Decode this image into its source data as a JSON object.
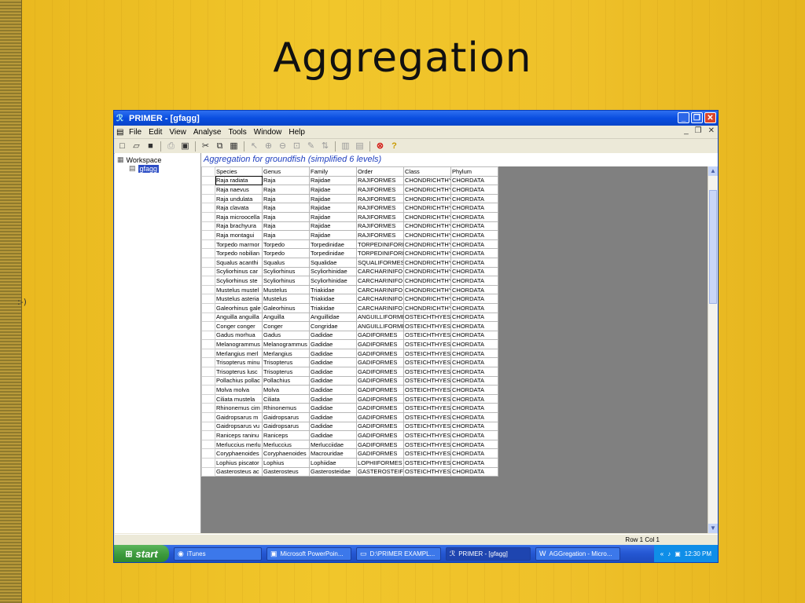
{
  "slide": {
    "title": "Aggregation",
    "side_note": ":-)"
  },
  "window": {
    "title": "PRIMER - [gfagg]"
  },
  "menu": [
    "File",
    "Edit",
    "View",
    "Analyse",
    "Tools",
    "Window",
    "Help"
  ],
  "toolbar_icons": [
    "new-icon",
    "open-icon",
    "save-icon",
    "print-icon",
    "print-preview-icon",
    "cut-icon",
    "copy-icon",
    "paste-icon",
    "pointer-icon",
    "zoom-in-icon",
    "zoom-out-icon",
    "select-icon",
    "edit-icon",
    "sort-icon",
    "chart-icon",
    "chart2-icon",
    "stop-icon",
    "help-icon"
  ],
  "tree": {
    "root": "Workspace",
    "child": "gfagg"
  },
  "sheet": {
    "title": "Aggregation for groundfish (simplified 6 levels)",
    "columns": [
      "Species",
      "Genus",
      "Family",
      "Order",
      "Class",
      "Phylum"
    ],
    "rows": [
      [
        "Raja radiata",
        "Raja",
        "Rajidae",
        "RAJIFORMES",
        "CHONDRICHTHY",
        "CHORDATA"
      ],
      [
        "Raja naevus",
        "Raja",
        "Rajidae",
        "RAJIFORMES",
        "CHONDRICHTHY",
        "CHORDATA"
      ],
      [
        "Raja undulata",
        "Raja",
        "Rajidae",
        "RAJIFORMES",
        "CHONDRICHTHY",
        "CHORDATA"
      ],
      [
        "Raja clavata",
        "Raja",
        "Rajidae",
        "RAJIFORMES",
        "CHONDRICHTHY",
        "CHORDATA"
      ],
      [
        "Raja microocella",
        "Raja",
        "Rajidae",
        "RAJIFORMES",
        "CHONDRICHTHY",
        "CHORDATA"
      ],
      [
        "Raja brachyura",
        "Raja",
        "Rajidae",
        "RAJIFORMES",
        "CHONDRICHTHY",
        "CHORDATA"
      ],
      [
        "Raja montagui",
        "Raja",
        "Rajidae",
        "RAJIFORMES",
        "CHONDRICHTHY",
        "CHORDATA"
      ],
      [
        "Torpedo marmor",
        "Torpedo",
        "Torpedinidae",
        "TORPEDINIFORI",
        "CHONDRICHTHY",
        "CHORDATA"
      ],
      [
        "Torpedo nobilian",
        "Torpedo",
        "Torpedinidae",
        "TORPEDINIFORI",
        "CHONDRICHTHY",
        "CHORDATA"
      ],
      [
        "Squalus acanthi",
        "Squalus",
        "Squalidae",
        "SQUALIFORMES",
        "CHONDRICHTHY",
        "CHORDATA"
      ],
      [
        "Scyliorhinus car",
        "Scyliorhinus",
        "Scyliorhinidae",
        "CARCHARINIFO",
        "CHONDRICHTHY",
        "CHORDATA"
      ],
      [
        "Scyliorhinus ste",
        "Scyliorhinus",
        "Scyliorhinidae",
        "CARCHARINIFO",
        "CHONDRICHTHY",
        "CHORDATA"
      ],
      [
        "Mustelus mustel",
        "Mustelus",
        "Triakidae",
        "CARCHARINIFO",
        "CHONDRICHTHY",
        "CHORDATA"
      ],
      [
        "Mustelus asteria",
        "Mustelus",
        "Triakidae",
        "CARCHARINIFO",
        "CHONDRICHTHY",
        "CHORDATA"
      ],
      [
        "Galeorhinus gale",
        "Galeorhinus",
        "Triakidae",
        "CARCHARINIFO",
        "CHONDRICHTHY",
        "CHORDATA"
      ],
      [
        "Anguilla anguilla",
        "Anguilla",
        "Anguillidae",
        "ANGUILLIFORME",
        "OSTEICHTHYES",
        "CHORDATA"
      ],
      [
        "Conger conger",
        "Conger",
        "Congridae",
        "ANGUILLIFORME",
        "OSTEICHTHYES",
        "CHORDATA"
      ],
      [
        "Gadus morhua",
        "Gadus",
        "Gadidae",
        "GADIFORMES",
        "OSTEICHTHYES",
        "CHORDATA"
      ],
      [
        "Melanogrammus",
        "Melanogrammus",
        "Gadidae",
        "GADIFORMES",
        "OSTEICHTHYES",
        "CHORDATA"
      ],
      [
        "Merlangius merl",
        "Merlangius",
        "Gadidae",
        "GADIFORMES",
        "OSTEICHTHYES",
        "CHORDATA"
      ],
      [
        "Trisopterus minu",
        "Trisopterus",
        "Gadidae",
        "GADIFORMES",
        "OSTEICHTHYES",
        "CHORDATA"
      ],
      [
        "Trisopterus lusc",
        "Trisopterus",
        "Gadidae",
        "GADIFORMES",
        "OSTEICHTHYES",
        "CHORDATA"
      ],
      [
        "Pollachius pollac",
        "Pollachius",
        "Gadidae",
        "GADIFORMES",
        "OSTEICHTHYES",
        "CHORDATA"
      ],
      [
        "Molva molva",
        "Molva",
        "Gadidae",
        "GADIFORMES",
        "OSTEICHTHYES",
        "CHORDATA"
      ],
      [
        "Ciliata mustela",
        "Ciliata",
        "Gadidae",
        "GADIFORMES",
        "OSTEICHTHYES",
        "CHORDATA"
      ],
      [
        "Rhinonemus cim",
        "Rhinonemus",
        "Gadidae",
        "GADIFORMES",
        "OSTEICHTHYES",
        "CHORDATA"
      ],
      [
        "Gaidropsarus m",
        "Gaidropsarus",
        "Gadidae",
        "GADIFORMES",
        "OSTEICHTHYES",
        "CHORDATA"
      ],
      [
        "Gaidropsarus vu",
        "Gaidropsarus",
        "Gadidae",
        "GADIFORMES",
        "OSTEICHTHYES",
        "CHORDATA"
      ],
      [
        "Raniceps raninu",
        "Raniceps",
        "Gadidae",
        "GADIFORMES",
        "OSTEICHTHYES",
        "CHORDATA"
      ],
      [
        "Merluccius merlu",
        "Merluccius",
        "Merlucciidae",
        "GADIFORMES",
        "OSTEICHTHYES",
        "CHORDATA"
      ],
      [
        "Coryphaenoides",
        "Coryphaenoides",
        "Macrouridae",
        "GADIFORMES",
        "OSTEICHTHYES",
        "CHORDATA"
      ],
      [
        "Lophius piscator",
        "Lophius",
        "Lophiidae",
        "LOPHIIFORMES",
        "OSTEICHTHYES",
        "CHORDATA"
      ],
      [
        "Gasterosteus ac",
        "Gasterosteus",
        "Gasterosteidae",
        "GASTEROSTEIF",
        "OSTEICHTHYES",
        "CHORDATA"
      ]
    ]
  },
  "status": {
    "position": "Row 1  Col 1"
  },
  "taskbar": {
    "start": "start",
    "tasks": [
      {
        "icon": "itunes-icon",
        "label": "iTunes",
        "active": false
      },
      {
        "icon": "powerpoint-icon",
        "label": "Microsoft PowerPoin...",
        "active": false
      },
      {
        "icon": "folder-icon",
        "label": "D:\\PRIMER EXAMPL...",
        "active": false
      },
      {
        "icon": "primer-icon",
        "label": "PRIMER - [gfagg]",
        "active": true
      },
      {
        "icon": "word-icon",
        "label": "AGGregation - Micro...",
        "active": false
      }
    ],
    "clock": "12:30 PM"
  }
}
